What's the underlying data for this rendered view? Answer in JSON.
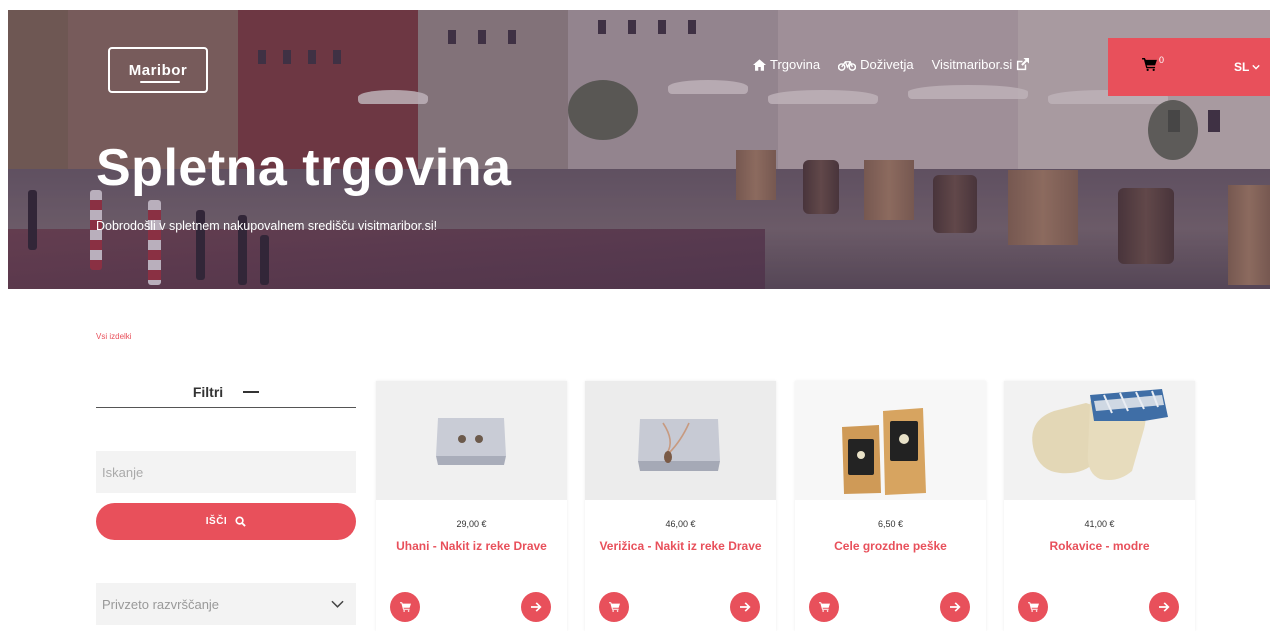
{
  "brand": {
    "logo_text": "Maribor"
  },
  "nav": {
    "items": [
      {
        "label": "Trgovina",
        "icon": "home-icon"
      },
      {
        "label": "Doživetja",
        "icon": "bicycle-icon"
      },
      {
        "label": "Visitmaribor.si",
        "icon": "external-link-icon"
      }
    ],
    "cart_count": "0",
    "language": "SL"
  },
  "hero": {
    "title": "Spletna trgovina",
    "subtitle": "Dobrodošli v spletnem nakupovalnem središču visitmaribor.si!"
  },
  "breadcrumb": {
    "label": "Vsi izdelki"
  },
  "filters": {
    "title": "Filtri",
    "search_placeholder": "Iskanje",
    "search_button": "IŠČI",
    "sort_value": "Privzeto razvrščanje"
  },
  "products": [
    {
      "price": "29,00 €",
      "name": "Uhani - Nakit iz reke Drave"
    },
    {
      "price": "46,00 €",
      "name": "Verižica - Nakit iz reke Drave"
    },
    {
      "price": "6,50 €",
      "name": "Cele grozdne peške"
    },
    {
      "price": "41,00 €",
      "name": "Rokavice - modre"
    }
  ],
  "colors": {
    "accent": "#e8505b",
    "input_bg": "#f3f3f3"
  }
}
